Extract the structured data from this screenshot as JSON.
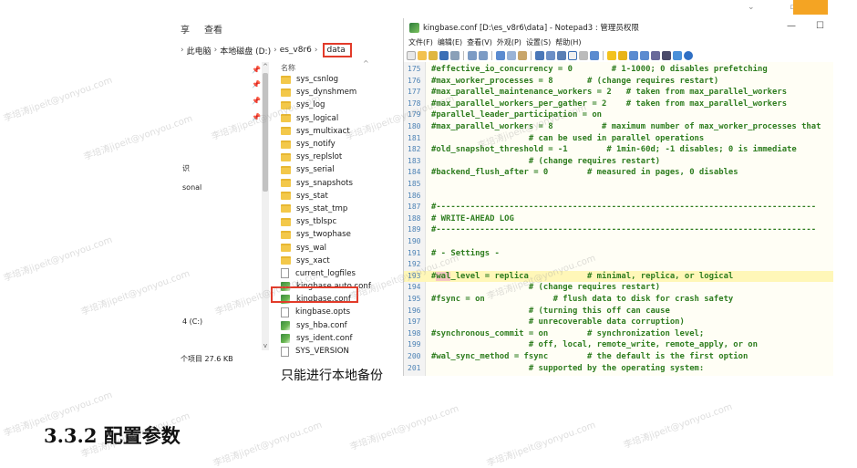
{
  "explorer": {
    "ribbon": [
      "享",
      "查看"
    ],
    "breadcrumbs": [
      "此电脑",
      "本地磁盘 (D:)",
      "es_v8r6"
    ],
    "current_folder": "data",
    "column_header": "名称",
    "nav_labels": [
      "识",
      "sonal",
      "4 (C:)"
    ],
    "files": [
      {
        "name": "sys_csnlog",
        "type": "folder"
      },
      {
        "name": "sys_dynshmem",
        "type": "folder"
      },
      {
        "name": "sys_log",
        "type": "folder"
      },
      {
        "name": "sys_logical",
        "type": "folder"
      },
      {
        "name": "sys_multixact",
        "type": "folder"
      },
      {
        "name": "sys_notify",
        "type": "folder"
      },
      {
        "name": "sys_replslot",
        "type": "folder"
      },
      {
        "name": "sys_serial",
        "type": "folder"
      },
      {
        "name": "sys_snapshots",
        "type": "folder"
      },
      {
        "name": "sys_stat",
        "type": "folder"
      },
      {
        "name": "sys_stat_tmp",
        "type": "folder"
      },
      {
        "name": "sys_tblspc",
        "type": "folder"
      },
      {
        "name": "sys_twophase",
        "type": "folder"
      },
      {
        "name": "sys_wal",
        "type": "folder"
      },
      {
        "name": "sys_xact",
        "type": "folder"
      },
      {
        "name": "current_logfiles",
        "type": "doc"
      },
      {
        "name": "kingbase.auto.conf",
        "type": "np"
      },
      {
        "name": "kingbase.conf",
        "type": "np",
        "selected": true
      },
      {
        "name": "kingbase.opts",
        "type": "doc"
      },
      {
        "name": "sys_hba.conf",
        "type": "np"
      },
      {
        "name": "sys_ident.conf",
        "type": "np"
      },
      {
        "name": "SYS_VERSION",
        "type": "doc"
      }
    ],
    "status": "个项目 27.6 KB",
    "below_text": "只能进行本地备份"
  },
  "notepad": {
    "title": "kingbase.conf [D:\\es_v8r6\\data] - Notepad3 : 管理员权限",
    "minimize": "—",
    "maximize": "☐",
    "menu": [
      "文件(F)",
      "编辑(E)",
      "查看(V)",
      "外观(P)",
      "设置(S)",
      "帮助(H)"
    ],
    "lines": [
      {
        "n": "175",
        "text": "#effective_io_concurrency = 0        # 1-1000; 0 disables prefetching"
      },
      {
        "n": "176",
        "text": "#max_worker_processes = 8       # (change requires restart)"
      },
      {
        "n": "177",
        "text": "#max_parallel_maintenance_workers = 2   # taken from max_parallel_workers"
      },
      {
        "n": "178",
        "text": "#max_parallel_workers_per_gather = 2    # taken from max_parallel_workers"
      },
      {
        "n": "179",
        "text": "#parallel_leader_participation = on"
      },
      {
        "n": "180",
        "text": "#max_parallel_workers = 8          # maximum number of max_worker_processes that"
      },
      {
        "n": "181",
        "text": "                    # can be used in parallel operations"
      },
      {
        "n": "182",
        "text": "#old_snapshot_threshold = -1        # 1min-60d; -1 disables; 0 is immediate"
      },
      {
        "n": "183",
        "text": "                    # (change requires restart)"
      },
      {
        "n": "184",
        "text": "#backend_flush_after = 0        # measured in pages, 0 disables"
      },
      {
        "n": "185",
        "text": ""
      },
      {
        "n": "186",
        "text": ""
      },
      {
        "n": "187",
        "text": "#------------------------------------------------------------------------------"
      },
      {
        "n": "188",
        "text": "# WRITE-AHEAD LOG"
      },
      {
        "n": "189",
        "text": "#------------------------------------------------------------------------------"
      },
      {
        "n": "190",
        "text": ""
      },
      {
        "n": "191",
        "text": "# - Settings -"
      },
      {
        "n": "192",
        "text": ""
      },
      {
        "n": "193",
        "text": "#wal_level = replica            # minimal, replica, or logical",
        "current": true
      },
      {
        "n": "194",
        "text": "                    # (change requires restart)"
      },
      {
        "n": "195",
        "text": "#fsync = on              # flush data to disk for crash safety"
      },
      {
        "n": "196",
        "text": "                    # (turning this off can cause"
      },
      {
        "n": "197",
        "text": "                    # unrecoverable data corruption)"
      },
      {
        "n": "198",
        "text": "#synchronous_commit = on        # synchronization level;"
      },
      {
        "n": "199",
        "text": "                    # off, local, remote_write, remote_apply, or on"
      },
      {
        "n": "200",
        "text": "#wal_sync_method = fsync        # the default is the first option"
      },
      {
        "n": "201",
        "text": "                    # supported by the operating system:"
      }
    ]
  },
  "heading": "3.3.2 配置参数",
  "watermark": "李培涛jipeit@yonyou.com"
}
